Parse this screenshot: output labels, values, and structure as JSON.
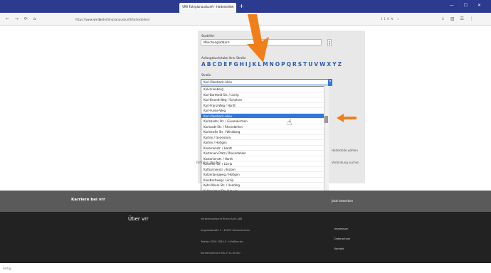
{
  "browser": {
    "tab_title": "VRR Fahrplanauskunft - Haltestellen",
    "tab_close": "×",
    "newtab": "+",
    "window_controls": "— ☐ ✕",
    "nav_icons": "← → ⟳ ⌂",
    "url_prefix": "https://www.",
    "url_domain": "vrr.de",
    "url_path": "/de/fahrplanauskunft/haltestellen/",
    "zoom": "110% ☆",
    "right_icons": "↓ ▥ ☰ ⋮"
  },
  "form": {
    "stadt_label": "Stadt/Ort",
    "stadt_value": "Mönchengladbach",
    "anfang_label": "Anfangsbuchstabe Ihrer Straße",
    "letters": [
      "A",
      "B",
      "C",
      "D",
      "E",
      "F",
      "G",
      "H",
      "I",
      "J",
      "K",
      "L",
      "M",
      "N",
      "O",
      "P",
      "Q",
      "R",
      "S",
      "T",
      "U",
      "V",
      "W",
      "X",
      "Y",
      "Z"
    ],
    "strasse_label": "Straße",
    "strasse_value": "Karl-Oberbach-Allee"
  },
  "dropdown": {
    "options": [
      "Kalvarienberg",
      "Karl-Barthold-Str. / Lürrip",
      "Karl-Brandt-Weg / Schelsen",
      "Karl-Franz-Weg / Hardt",
      "Karl-Funke-Weg",
      "Karl-Oberbach-Allee",
      "Karlsbader Str. / Giesenkirchen",
      "Karlstadt-Str. / Rheindahlen",
      "Karlstraße Str. / Windberg",
      "Karten / Geneicken",
      "Karten / Holtgen",
      "Kasernenstr. / Hardt",
      "Kastanien-Platz / Rheindahlen",
      "Kastanienstr. / Hardt",
      "Kasseler Str. / Lürrip",
      "Katharinenstr. / Eicken",
      "Katzenbergweg / Holtgen",
      "Kaulbachweg / Lürrip",
      "Kehr-Moors-Str. / Uedding",
      "Keldenicher Str. / Heyen",
      "Kettelerstr. / Westend"
    ],
    "highlighted_index": 5
  },
  "page": {
    "side_text_1": "Haltestelle wählen",
    "side_text_2": "Verbindung suchen",
    "side_text_3": "Fahrplan abrufen"
  },
  "gray_band": {
    "label": "Karriere bei vrr",
    "right_text": "Jetzt bewerben"
  },
  "footer": {
    "title": "Über vrr",
    "lines": [
      "Verkehrsverbund Rhein-Ruhr AöR",
      "Augustastraße 1 · 45879 Gelsenkirchen",
      "Telefon 0209 1584-0 · info@vrr.de",
      "Kundenzentrum Mo–Fr 8–18 Uhr"
    ],
    "links": [
      "Impressum",
      "Datenschutz",
      "Kontakt"
    ]
  },
  "status": {
    "text": "Fertig"
  },
  "colors": {
    "accent_orange": "#f07f1a",
    "link_blue": "#2a5db0",
    "highlight": "#3378d6",
    "titlebar": "#2c3b8e",
    "footer": "#222222"
  }
}
